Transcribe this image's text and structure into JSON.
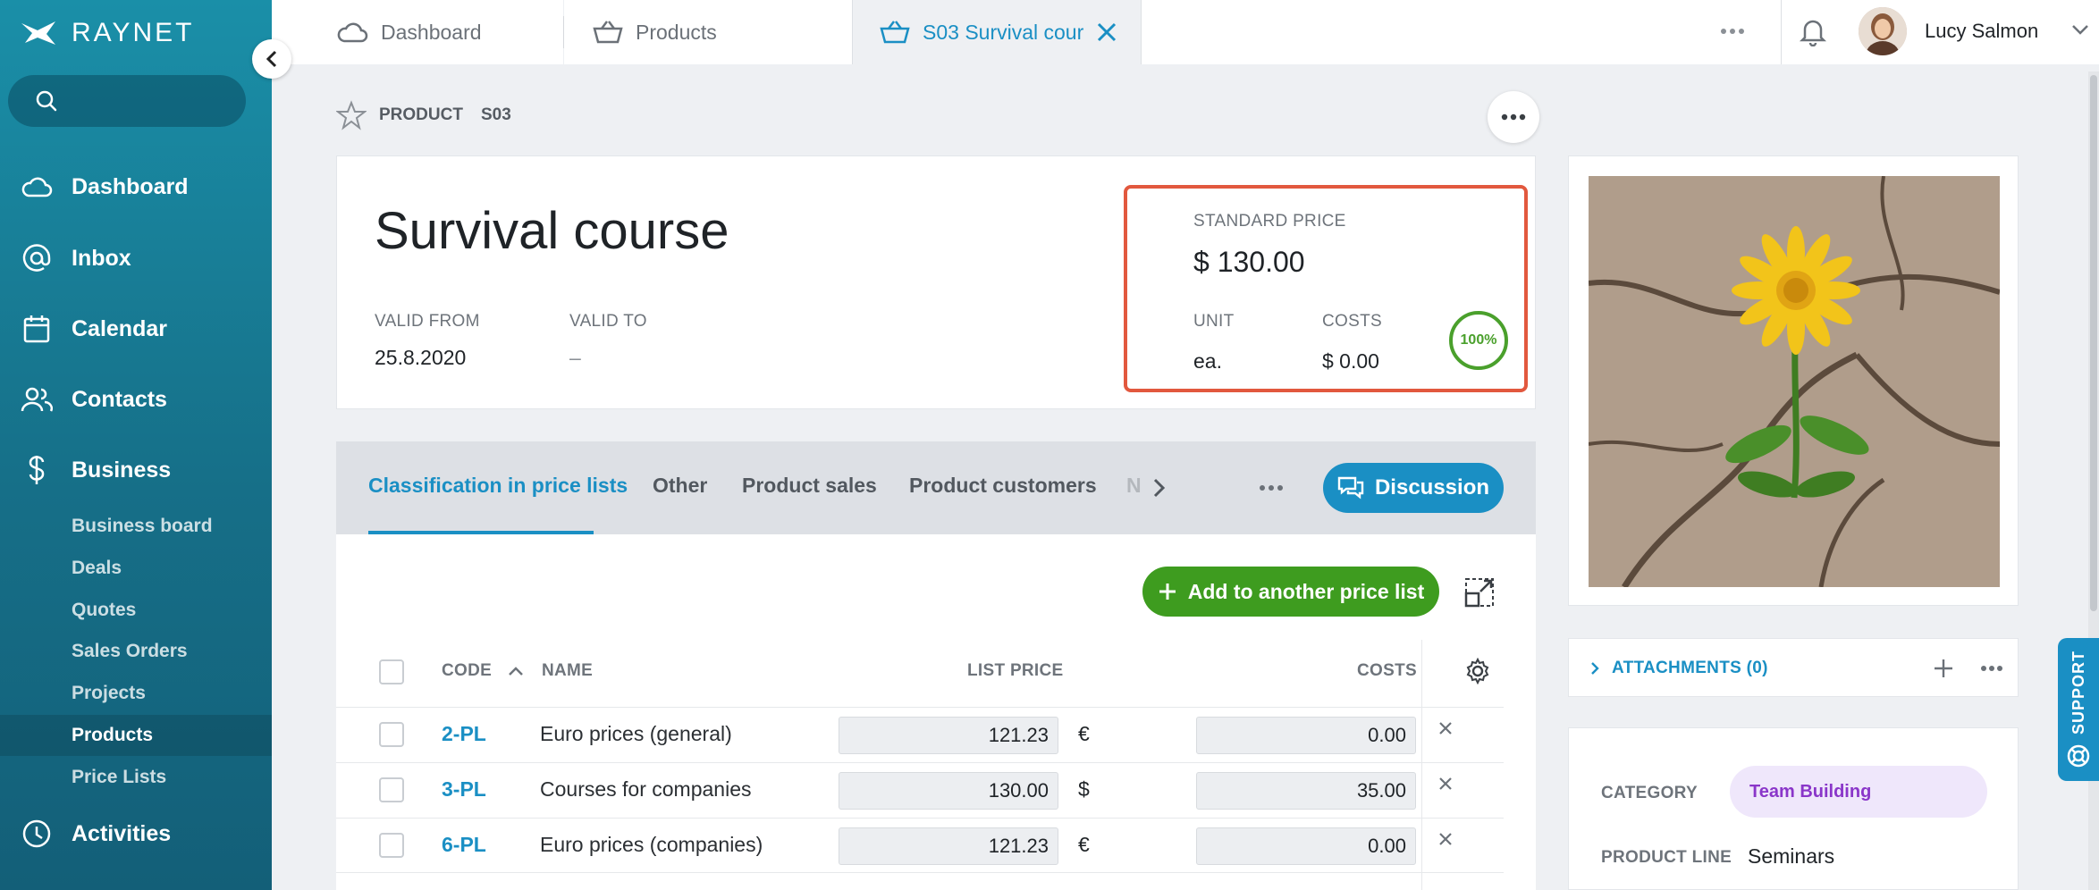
{
  "app": {
    "brand": "RAYNET"
  },
  "sidebar": {
    "search_placeholder": "",
    "nav": [
      {
        "label": "Dashboard",
        "icon": "cloud-icon"
      },
      {
        "label": "Inbox",
        "icon": "at-icon"
      },
      {
        "label": "Calendar",
        "icon": "calendar-icon"
      },
      {
        "label": "Contacts",
        "icon": "contacts-icon"
      },
      {
        "label": "Business",
        "icon": "dollar-icon"
      }
    ],
    "sub_items": [
      "Business board",
      "Deals",
      "Quotes",
      "Sales Orders",
      "Projects",
      "Products",
      "Price Lists"
    ],
    "active_sub": "Products",
    "activities": {
      "label": "Activities",
      "icon": "clock-icon"
    }
  },
  "topbar": {
    "tabs": [
      {
        "label": "Dashboard",
        "icon": "cloud-icon"
      },
      {
        "label": "Products",
        "icon": "basket-icon"
      },
      {
        "label": "S03 Survival cour",
        "icon": "basket-icon",
        "active": true
      }
    ],
    "user_name": "Lucy Salmon"
  },
  "breadcrumb": {
    "type": "PRODUCT",
    "code": "S03"
  },
  "product": {
    "title": "Survival course",
    "valid_from_label": "VALID FROM",
    "valid_from": "25.8.2020",
    "valid_to_label": "VALID TO",
    "valid_to": "–",
    "standard_price_label": "STANDARD PRICE",
    "standard_price": "$ 130.00",
    "unit_label": "UNIT",
    "unit": "ea.",
    "costs_label": "COSTS",
    "costs": "$ 0.00",
    "margin_pct": "100%"
  },
  "product_tabs": {
    "tabs": [
      "Classification in price lists",
      "Other",
      "Product sales",
      "Product customers",
      "N"
    ],
    "active": "Classification in price lists",
    "discussion_label": "Discussion",
    "add_label": "Add to another price list"
  },
  "table": {
    "headers": {
      "code": "CODE",
      "name": "NAME",
      "list_price": "LIST PRICE",
      "costs": "COSTS"
    },
    "rows": [
      {
        "code": "2-PL",
        "name": "Euro prices (general)",
        "list_price": "121.23",
        "currency": "€",
        "costs": "0.00"
      },
      {
        "code": "3-PL",
        "name": "Courses for companies",
        "list_price": "130.00",
        "currency": "$",
        "costs": "35.00"
      },
      {
        "code": "6-PL",
        "name": "Euro prices (companies)",
        "list_price": "121.23",
        "currency": "€",
        "costs": "0.00"
      }
    ]
  },
  "side": {
    "attachments_label": "ATTACHMENTS (0)",
    "category_label": "CATEGORY",
    "category_value": "Team Building",
    "product_line_label": "PRODUCT LINE",
    "product_line_value": "Seminars",
    "support_label": "SUPPORT"
  },
  "colors": {
    "accent": "#1a8fc4",
    "highlight_border": "#e2583e",
    "success": "#3e9c1f",
    "sidebar": "#166f88"
  }
}
